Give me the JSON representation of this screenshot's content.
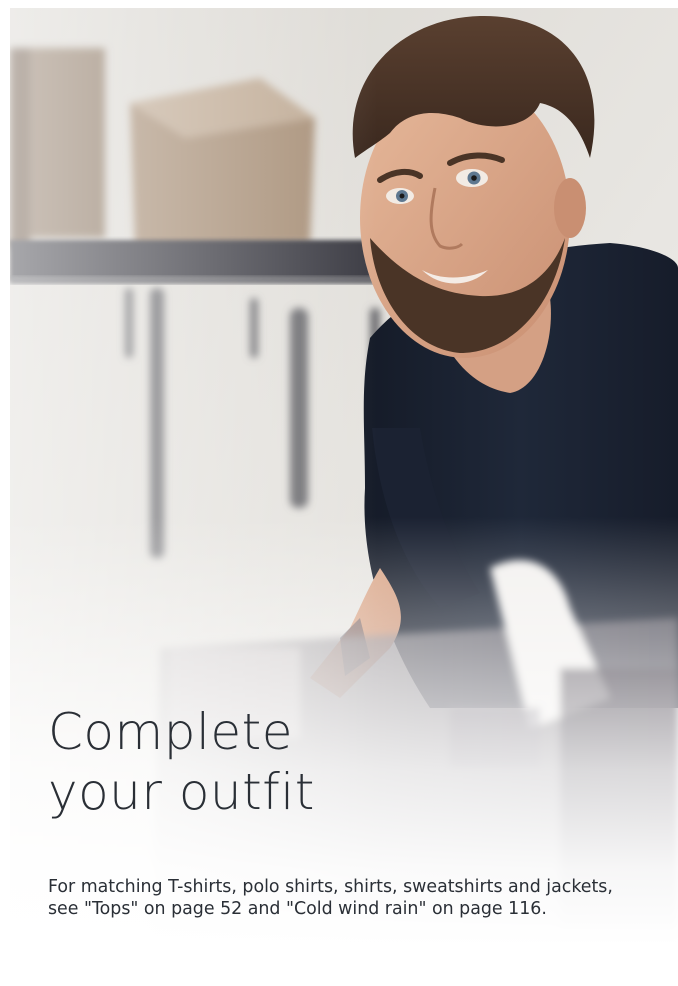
{
  "headline": {
    "line1": "Complete",
    "line2": "your outfit"
  },
  "body": {
    "text": "For matching T-shirts, polo shirts, shirts, sweatshirts and jackets, see \"Tops\" on page 52 and \"Cold wind rain\" on page 116."
  },
  "colors": {
    "text": "#2a2f36",
    "shirt": "#1c2434",
    "background": "#ffffff"
  }
}
